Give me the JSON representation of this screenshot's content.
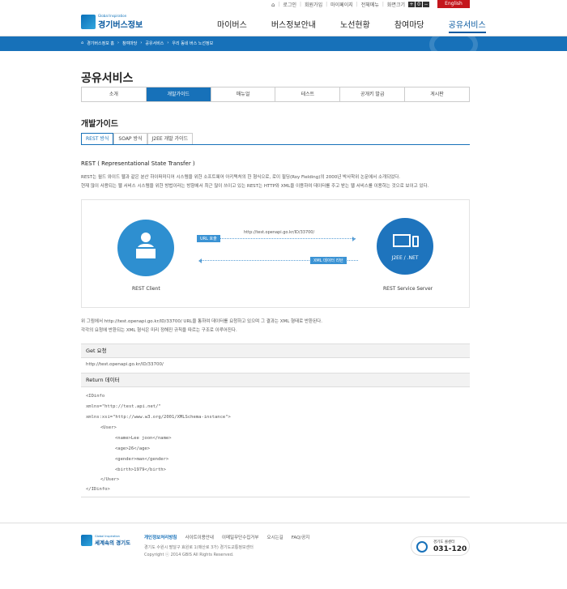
{
  "util": {
    "items": [
      "로그인",
      "회원가입",
      "마이페이지",
      "전체메뉴"
    ],
    "font_label": "화면크기",
    "english": "English"
  },
  "header": {
    "logo_sub": "Global Inspiration",
    "logo_main": "경기버스정보",
    "nav": [
      "마이버스",
      "버스정보안내",
      "노선현황",
      "참여마당",
      "공유서비스"
    ]
  },
  "breadcrumb": [
    "경기버스정보 홈",
    "참여마당",
    "공유서비스",
    "우리 동네 버스 노선정보"
  ],
  "page_title": "공유서비스",
  "tabs": [
    "소개",
    "개발가이드",
    "매뉴얼",
    "테스트",
    "공개키 발급",
    "게시판"
  ],
  "sub_title": "개발가이드",
  "subtabs": [
    "REST 방식",
    "SOAP 방식",
    "J2EE 개발 가이드"
  ],
  "section_head": "REST ( Representational State Transfer )",
  "desc_lines": [
    "REST는 월드 와이드 웹과 같은 분산 하이퍼미디어 시스템을 위한 소프트웨어 아키텍처의 한 형식으로, 로이 필딩(Roy Fielding)의 2000년 박사학위 논문에서 소개되었다.",
    "현재 많이 사용되는 웹 서비스 시스템을 위한 방법이라는 방향에서 최근 많이 쓰이고 있는 REST는 HTTP와 XML을 이용하여 데이터를 주고 받는 웹 서비스를 이용하는 것으로 보이고 있다."
  ],
  "diagram": {
    "url_pill": "URL 호출",
    "url_text": "http://test.openapi.go.kr/ID/33700/",
    "xml_pill": "XML 데이터 리턴",
    "right_label": "J2EE / .NET",
    "left_caption": "REST Client",
    "right_caption": "REST Service Server"
  },
  "explain_lines": [
    "위 그림에서 http://test.openapi.go.kr/ID/33700/ URL을 통하여 데이터를 요청하고 있으며 그 결과는 XML 형태로 반환된다.",
    "각각의 요청에 반환되는 XML 형식은 미리 정해진 규칙을 따르는 구조로 이루어진다."
  ],
  "get": {
    "head": "Get 요청",
    "url": "http://test.openapi.go.kr/ID/33700/"
  },
  "return_head": "Return 데이터",
  "code": [
    "<IDinfo",
    " xmlns=\"http://test.api.net/\"",
    " xmlns:xsi=\"http://www.w3.org/2001/XMLSchema-instance\">",
    "<User>",
    "<name>Lee joon</name>",
    "<age>26</age>",
    "<gender>man</gender>",
    "<birth>1979</birth>",
    "</User>",
    "</IDinfo>"
  ],
  "footer": {
    "logo_sub": "Global Inspiration",
    "logo_main": "세계속의 경기도",
    "links": [
      "개인정보처리방침",
      "사이트이용안내",
      "이메일무단수집거부",
      "오시는길",
      "FAQ/공지"
    ],
    "addr1": "경기도 수원시 팔달구 효원로 1(매산로 3가) 경기도교통정보센터",
    "addr2": "Copyright ⓒ 2014 GBIS All Rights Reserved.",
    "cc_label": "경기도 콜센터",
    "cc_num": "031-120"
  },
  "colors": {
    "brand": "#1771b9",
    "english_bg": "#c4161c"
  }
}
